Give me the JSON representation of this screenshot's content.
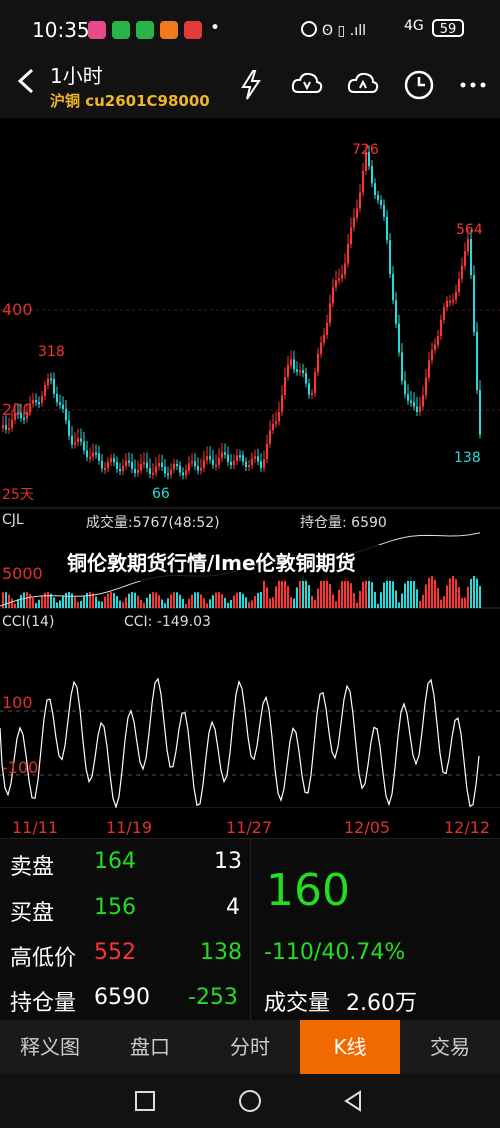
{
  "status": {
    "time": "10:35",
    "network": "4G",
    "battery": "59"
  },
  "header": {
    "title": "1小时",
    "subtitle": "沪铜 cu2601C98000"
  },
  "chart": {
    "price_axis": [
      "400",
      "200"
    ],
    "peaks": [
      "726",
      "564",
      "318"
    ],
    "lows": [
      "66",
      "138"
    ],
    "ma_label": "25天",
    "volume": {
      "name": "CJL",
      "volume_text": "成交量:5767(48:52)",
      "oi_text": "持仓量: 6590",
      "axis": "5000"
    },
    "cci": {
      "name": "CCI(14)",
      "value_text": "CCI: -149.03",
      "levels": [
        "100",
        "-100"
      ]
    },
    "dates": [
      "11/11",
      "11/19",
      "11/27",
      "12/05",
      "12/12"
    ]
  },
  "caption": "铜伦敦期货行情/lme伦敦铜期货",
  "quote": {
    "sell_label": "卖盘",
    "sell_price": "164",
    "sell_vol": "13",
    "buy_label": "买盘",
    "buy_price": "156",
    "buy_vol": "4",
    "hl_label": "高低价",
    "high": "552",
    "low": "138",
    "oi_label": "持仓量",
    "oi": "6590",
    "oi_change": "-253",
    "last": "160",
    "change": "-110/40.74%",
    "volume_label": "成交量",
    "volume": "2.60万"
  },
  "tabs": [
    "释义图",
    "盘口",
    "分时",
    "K线",
    "交易"
  ],
  "colors": {
    "up": "#ff3333",
    "down": "#22dddd",
    "accent": "#f06a00",
    "green": "#22dd22"
  }
}
